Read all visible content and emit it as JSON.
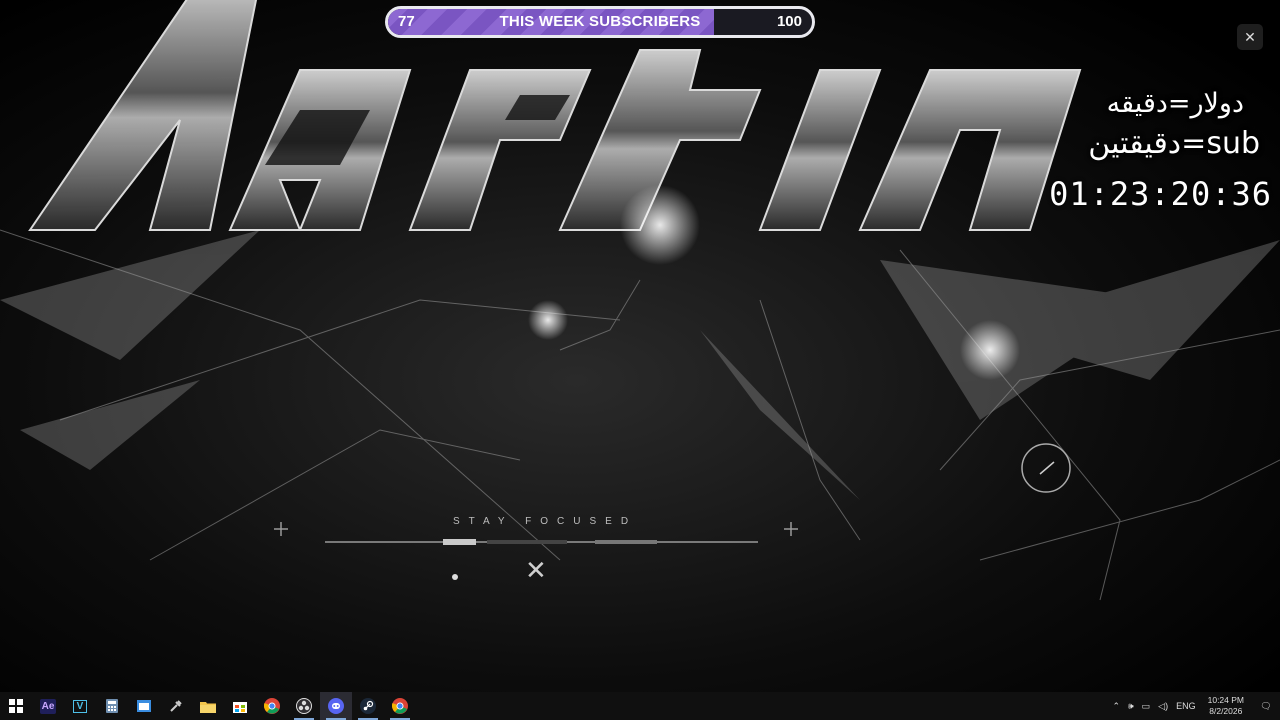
{
  "subscriber_goal": {
    "current": "77",
    "title": "THIS WEEK SUBSCRIBERS",
    "target": "100",
    "progress": 0.77,
    "fill_color": "#8d68d2"
  },
  "overlay": {
    "rate_dollar": "دولار=دقيقه",
    "rate_sub": "sub=دقيقتين",
    "timer": "01:23:20:36"
  },
  "wallpaper": {
    "title_text": "Martin",
    "tagline": "STAY FOCUSED"
  },
  "close_button": {
    "icon": "close-icon"
  },
  "taskbar": {
    "apps": [
      {
        "name": "start",
        "icon": "windows-logo-icon"
      },
      {
        "name": "after-effects",
        "icon": "after-effects-icon",
        "label": "Ae"
      },
      {
        "name": "vegas",
        "icon": "vegas-icon",
        "label": "V"
      },
      {
        "name": "calculator",
        "icon": "calculator-icon"
      },
      {
        "name": "desktop",
        "icon": "window-icon"
      },
      {
        "name": "tool",
        "icon": "tool-icon"
      },
      {
        "name": "file-explorer",
        "icon": "folder-icon"
      },
      {
        "name": "store",
        "icon": "store-icon"
      },
      {
        "name": "chrome",
        "icon": "chrome-icon"
      },
      {
        "name": "obs",
        "icon": "obs-icon"
      },
      {
        "name": "discord",
        "icon": "discord-icon"
      },
      {
        "name": "steam",
        "icon": "steam-icon"
      },
      {
        "name": "chrome-2",
        "icon": "chrome-icon"
      }
    ],
    "tray": {
      "language": "ENG",
      "time": "10:24 PM",
      "date": "8/2/2026"
    }
  }
}
